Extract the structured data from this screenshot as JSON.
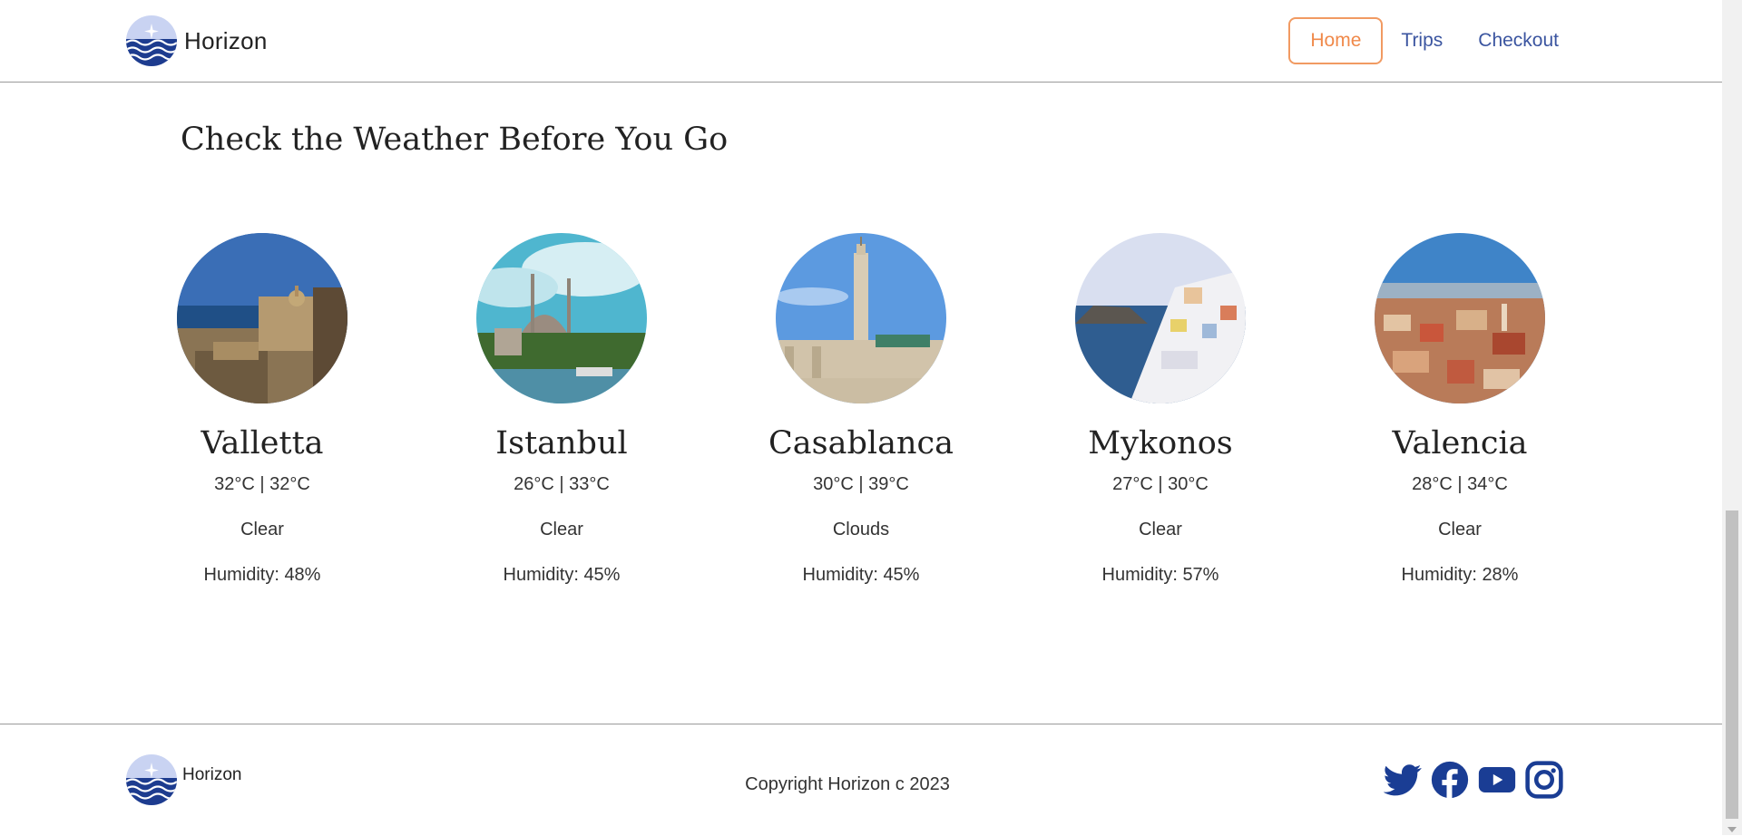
{
  "header": {
    "brand": "Horizon",
    "nav": [
      {
        "label": "Home",
        "active": true
      },
      {
        "label": "Trips"
      },
      {
        "label": "Checkout"
      }
    ]
  },
  "section_title": "Check the Weather Before You Go",
  "cities": [
    {
      "name": "Valletta",
      "temp": "32°C | 32°C",
      "condition": "Clear",
      "humidity": "Humidity: 48%"
    },
    {
      "name": "Istanbul",
      "temp": "26°C | 33°C",
      "condition": "Clear",
      "humidity": "Humidity: 45%"
    },
    {
      "name": "Casablanca",
      "temp": "30°C | 39°C",
      "condition": "Clouds",
      "humidity": "Humidity: 45%"
    },
    {
      "name": "Mykonos",
      "temp": "27°C | 30°C",
      "condition": "Clear",
      "humidity": "Humidity: 57%"
    },
    {
      "name": "Valencia",
      "temp": "28°C | 34°C",
      "condition": "Clear",
      "humidity": "Humidity: 28%"
    }
  ],
  "footer": {
    "brand": "Horizon",
    "copyright": "Copyright Horizon c 2023",
    "socials": [
      "twitter-icon",
      "facebook-icon",
      "youtube-icon",
      "instagram-icon"
    ]
  },
  "colors": {
    "accent": "#f0894a",
    "link": "#3b55a0",
    "brand_blue": "#1d3c8f",
    "social_blue": "#1a3d94"
  }
}
